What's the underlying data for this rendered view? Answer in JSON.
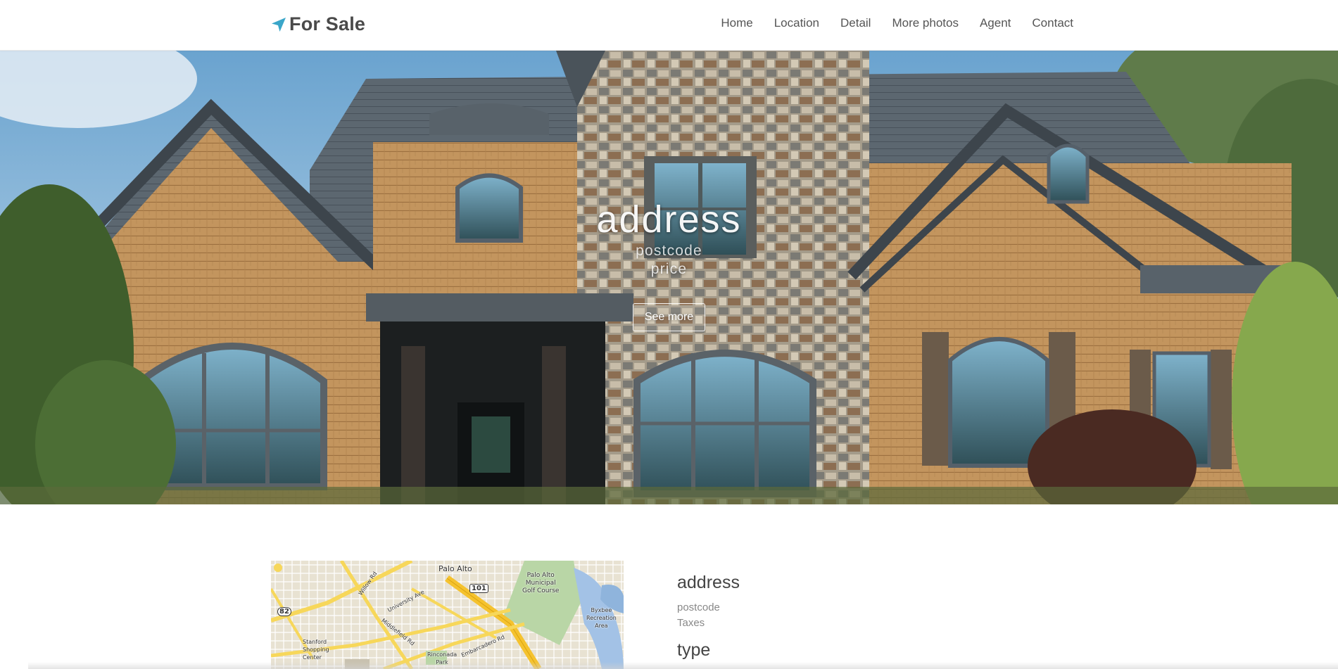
{
  "brand": {
    "label": "For Sale",
    "icon": "location-arrow-icon",
    "color": "#3aa6c9"
  },
  "nav": {
    "items": [
      {
        "label": "Home"
      },
      {
        "label": "Location"
      },
      {
        "label": "Detail"
      },
      {
        "label": "More photos"
      },
      {
        "label": "Agent"
      },
      {
        "label": "Contact"
      }
    ]
  },
  "hero": {
    "title": "address",
    "postcode": "postcode",
    "price": "price",
    "button_label": "See more"
  },
  "map": {
    "labels": {
      "palo_alto": "Palo Alto",
      "hwy_101": "101",
      "hwy_82": "82",
      "golf_course": "Palo Alto\nMunicipal\nGolf Course",
      "bixbee": "Byxbee\nRecreation\nArea",
      "willow_rd": "Willow Rd",
      "university_ave": "University Ave",
      "middlefield_rd": "Middlefield Rd",
      "embarcadero_rd": "Embarcadero Rd",
      "stanford": "Stanford\nShopping\nCenter",
      "rinconada": "Rinconada\nPark"
    }
  },
  "details": {
    "address": "address",
    "postcode": "postcode",
    "taxes": "Taxes",
    "type": "type"
  }
}
